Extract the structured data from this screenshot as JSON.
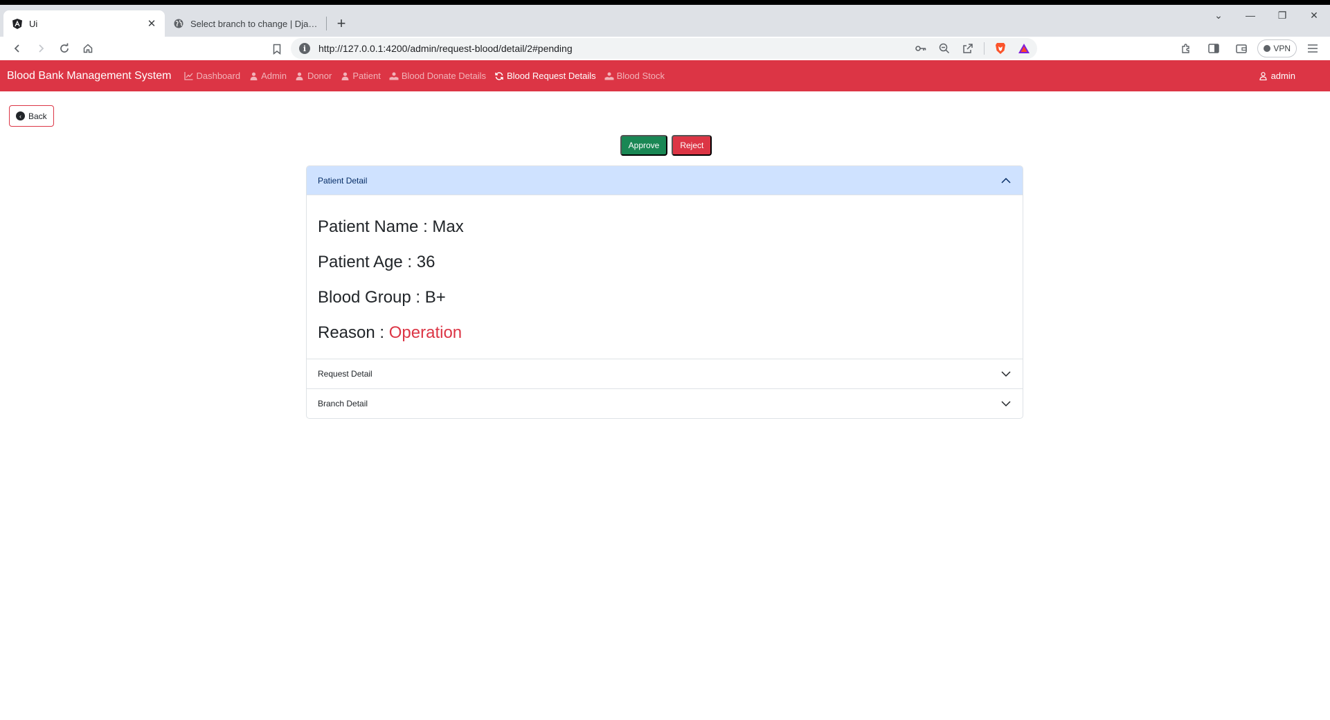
{
  "browser": {
    "tabs": [
      {
        "title": "Ui",
        "favicon": "angular-icon",
        "active": true
      },
      {
        "title": "Select branch to change | Django site admin",
        "favicon": "globe-icon",
        "active": false
      }
    ],
    "url": "http://127.0.0.1:4200/admin/request-blood/detail/2#pending",
    "vpn_label": "VPN"
  },
  "navbar": {
    "brand": "Blood Bank Management System",
    "links": [
      {
        "label": "Dashboard",
        "icon": "chart-line-icon",
        "active": false
      },
      {
        "label": "Admin",
        "icon": "user-icon",
        "active": false
      },
      {
        "label": "Donor",
        "icon": "user-icon",
        "active": false
      },
      {
        "label": "Patient",
        "icon": "user-icon",
        "active": false
      },
      {
        "label": "Blood Donate Details",
        "icon": "hand-user-icon",
        "active": false
      },
      {
        "label": "Blood Request Details",
        "icon": "refresh-icon",
        "active": true
      },
      {
        "label": "Blood Stock",
        "icon": "hand-user-icon",
        "active": false
      }
    ],
    "user": "admin"
  },
  "page": {
    "back_label": "Back",
    "approve_label": "Approve",
    "reject_label": "Reject"
  },
  "accordion": {
    "patient_header": "Patient Detail",
    "patient": {
      "name_label": "Patient Name : ",
      "name": "Max",
      "age_label": "Patient Age : ",
      "age": "36",
      "blood_group_label": "Blood Group : ",
      "blood_group": "B+",
      "reason_label": "Reason : ",
      "reason": "Operation"
    },
    "request_header": "Request Detail",
    "branch_header": "Branch Detail"
  },
  "colors": {
    "brand_red": "#dc3545",
    "approve_green": "#198754",
    "accordion_open_bg": "#cfe2ff"
  }
}
